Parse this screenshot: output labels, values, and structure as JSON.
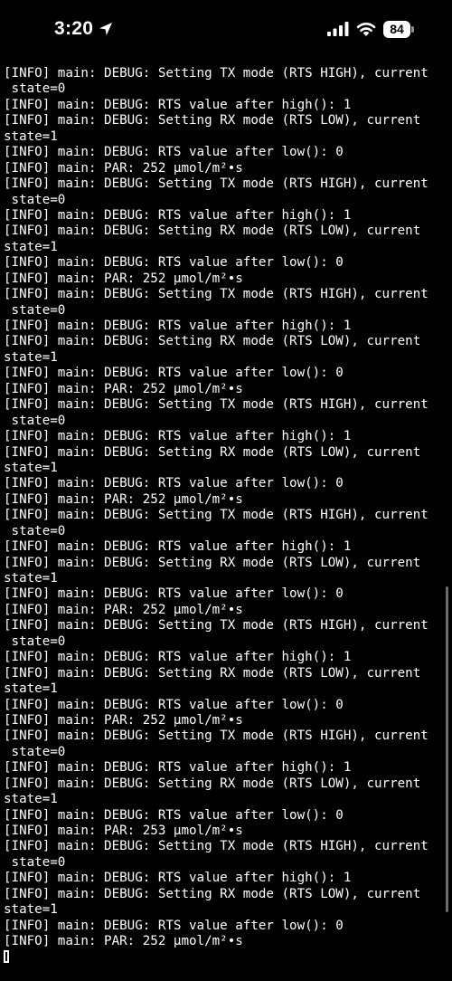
{
  "status_bar": {
    "time": "3:20",
    "battery_level": "84",
    "icons": [
      "location-arrow-icon",
      "cellular-signal-icon",
      "wifi-icon",
      "battery-icon"
    ]
  },
  "terminal": {
    "lines": [
      "[INFO] main: DEBUG: Setting TX mode (RTS HIGH), current",
      " state=0",
      "[INFO] main: DEBUG: RTS value after high(): 1",
      "[INFO] main: DEBUG: Setting RX mode (RTS LOW), current",
      "state=1",
      "[INFO] main: DEBUG: RTS value after low(): 0",
      "[INFO] main: PAR: 252 µmol/m²•s",
      "[INFO] main: DEBUG: Setting TX mode (RTS HIGH), current",
      " state=0",
      "[INFO] main: DEBUG: RTS value after high(): 1",
      "[INFO] main: DEBUG: Setting RX mode (RTS LOW), current",
      "state=1",
      "[INFO] main: DEBUG: RTS value after low(): 0",
      "[INFO] main: PAR: 252 µmol/m²•s",
      "[INFO] main: DEBUG: Setting TX mode (RTS HIGH), current",
      " state=0",
      "[INFO] main: DEBUG: RTS value after high(): 1",
      "[INFO] main: DEBUG: Setting RX mode (RTS LOW), current",
      "state=1",
      "[INFO] main: DEBUG: RTS value after low(): 0",
      "[INFO] main: PAR: 252 µmol/m²•s",
      "[INFO] main: DEBUG: Setting TX mode (RTS HIGH), current",
      " state=0",
      "[INFO] main: DEBUG: RTS value after high(): 1",
      "[INFO] main: DEBUG: Setting RX mode (RTS LOW), current",
      "state=1",
      "[INFO] main: DEBUG: RTS value after low(): 0",
      "[INFO] main: PAR: 252 µmol/m²•s",
      "[INFO] main: DEBUG: Setting TX mode (RTS HIGH), current",
      " state=0",
      "[INFO] main: DEBUG: RTS value after high(): 1",
      "[INFO] main: DEBUG: Setting RX mode (RTS LOW), current",
      "state=1",
      "[INFO] main: DEBUG: RTS value after low(): 0",
      "[INFO] main: PAR: 252 µmol/m²•s",
      "[INFO] main: DEBUG: Setting TX mode (RTS HIGH), current",
      " state=0",
      "[INFO] main: DEBUG: RTS value after high(): 1",
      "[INFO] main: DEBUG: Setting RX mode (RTS LOW), current",
      "state=1",
      "[INFO] main: DEBUG: RTS value after low(): 0",
      "[INFO] main: PAR: 252 µmol/m²•s",
      "[INFO] main: DEBUG: Setting TX mode (RTS HIGH), current",
      " state=0",
      "[INFO] main: DEBUG: RTS value after high(): 1",
      "[INFO] main: DEBUG: Setting RX mode (RTS LOW), current",
      "state=1",
      "[INFO] main: DEBUG: RTS value after low(): 0",
      "[INFO] main: PAR: 253 µmol/m²•s",
      "[INFO] main: DEBUG: Setting TX mode (RTS HIGH), current",
      " state=0",
      "[INFO] main: DEBUG: RTS value after high(): 1",
      "[INFO] main: DEBUG: Setting RX mode (RTS LOW), current",
      "state=1",
      "[INFO] main: DEBUG: RTS value after low(): 0",
      "[INFO] main: PAR: 252 µmol/m²•s"
    ]
  },
  "colors": {
    "background": "#000000",
    "text": "#ffffff",
    "scrollbar": "#6b6b6b"
  }
}
